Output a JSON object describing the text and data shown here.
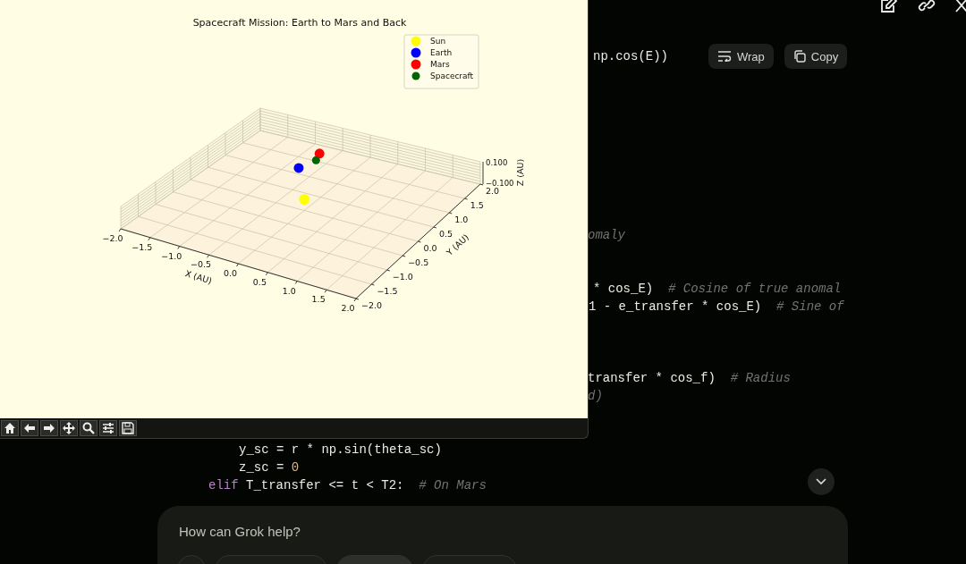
{
  "plot_window": {
    "title": "Spacecraft Mission: Earth to Mars and Back",
    "x_axis": {
      "label": "X (AU)",
      "ticks": [
        "−2.0",
        "−1.5",
        "−1.0",
        "−0.5",
        "0.0",
        "0.5",
        "1.0",
        "1.5",
        "2.0"
      ]
    },
    "y_axis": {
      "label": "Y (AU)",
      "ticks": [
        "−2.0",
        "−1.5",
        "−1.0",
        "−0.5",
        "0.0",
        "0.5",
        "1.0",
        "1.5",
        "2.0"
      ]
    },
    "z_axis": {
      "label": "Z (AU)",
      "ticks": [
        "0.100",
        "−0.100"
      ]
    },
    "legend": [
      {
        "name": "Sun",
        "color": "#ffff00"
      },
      {
        "name": "Earth",
        "color": "#0000ff"
      },
      {
        "name": "Mars",
        "color": "#ff0000"
      },
      {
        "name": "Spacecraft",
        "color": "#006400"
      }
    ]
  },
  "code_lines": [
    {
      "segments": [
        {
          "kind": "code",
          "text": "np.cos(E))"
        }
      ]
    },
    {
      "segments": [
        {
          "kind": "comment",
          "text": "omaly"
        }
      ]
    },
    {
      "segments": [
        {
          "kind": "code",
          "text": "* cos_E)  "
        },
        {
          "kind": "comment",
          "text": "# Cosine of true anomal"
        }
      ]
    },
    {
      "segments": [
        {
          "kind": "code",
          "text": "1 - e_transfer * cos_E)  "
        },
        {
          "kind": "comment",
          "text": "# Sine of"
        }
      ]
    },
    {
      "segments": [
        {
          "kind": "code",
          "text": "transfer * cos_f)  "
        },
        {
          "kind": "comment",
          "text": "# Radius"
        }
      ]
    },
    {
      "segments": [
        {
          "kind": "comment",
          "text": "d)"
        }
      ]
    },
    {
      "segments": [
        {
          "kind": "code",
          "text": "y_sc = r * np.sin(theta_sc)"
        }
      ]
    },
    {
      "segments": [
        {
          "kind": "code",
          "text": "z_sc = "
        },
        {
          "kind": "number",
          "text": "0"
        }
      ]
    },
    {
      "segments": [
        {
          "kind": "keyword",
          "text": "elif"
        },
        {
          "kind": "code",
          "text": " T_transfer <= t < T2:  "
        },
        {
          "kind": "comment",
          "text": "# On Mars"
        }
      ]
    }
  ],
  "code_actions": [
    {
      "label": "Wrap"
    },
    {
      "label": "Copy"
    }
  ],
  "composer": {
    "placeholder": "How can Grok help?"
  }
}
